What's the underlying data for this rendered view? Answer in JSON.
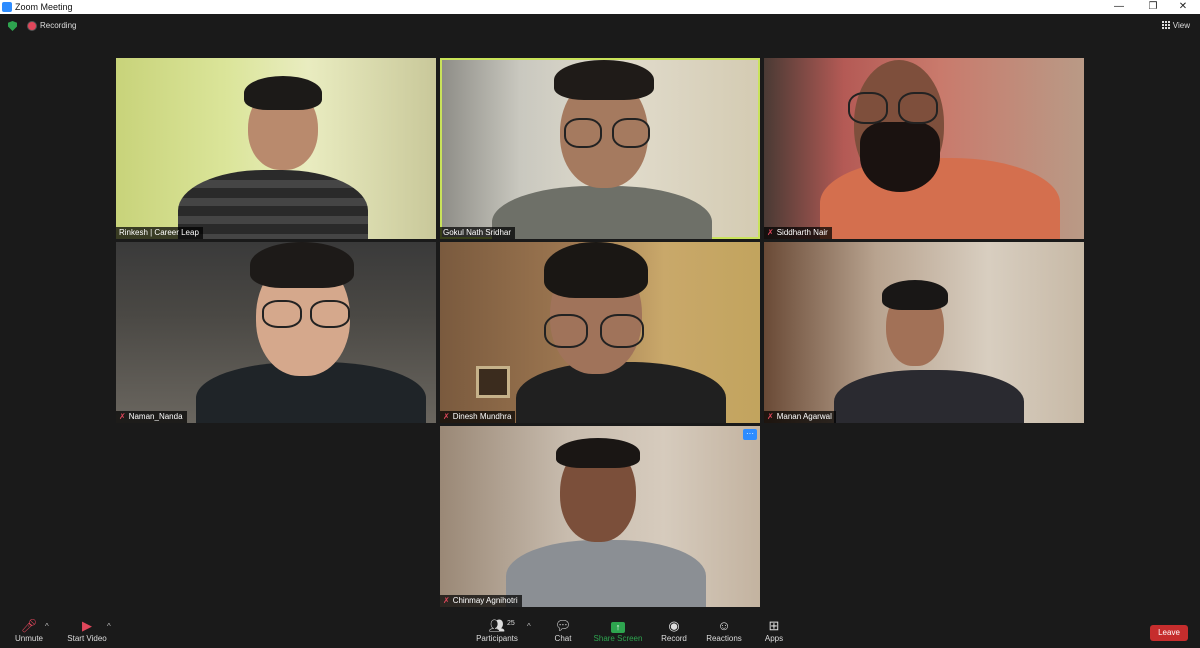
{
  "window": {
    "title": "Zoom Meeting",
    "minimize": "—",
    "restore": "❐",
    "close": "✕"
  },
  "status": {
    "recording_label": "Recording",
    "view_label": "View"
  },
  "participants": [
    {
      "name": "Rinkesh | Career Leap",
      "muted": false
    },
    {
      "name": "Gokul Nath Sridhar",
      "muted": false,
      "active_speaker": true
    },
    {
      "name": "Siddharth Nair",
      "muted": true
    },
    {
      "name": "Naman_Nanda",
      "muted": true
    },
    {
      "name": "Dinesh Mundhra",
      "muted": true
    },
    {
      "name": "Manan Agarwal",
      "muted": true
    },
    {
      "name": "Chinmay Agnihotri",
      "muted": true
    }
  ],
  "more_button": "···",
  "toolbar": {
    "unmute": "Unmute",
    "start_video": "Start Video",
    "participants": "Participants",
    "participants_count": "25",
    "chat": "Chat",
    "share_screen": "Share Screen",
    "record": "Record",
    "reactions": "Reactions",
    "apps": "Apps",
    "leave": "Leave",
    "caret": "^"
  },
  "colors": {
    "accent": "#2d8cff",
    "active_border": "#c9e35a",
    "leave": "#c62d2d",
    "share": "#2ea44f"
  }
}
